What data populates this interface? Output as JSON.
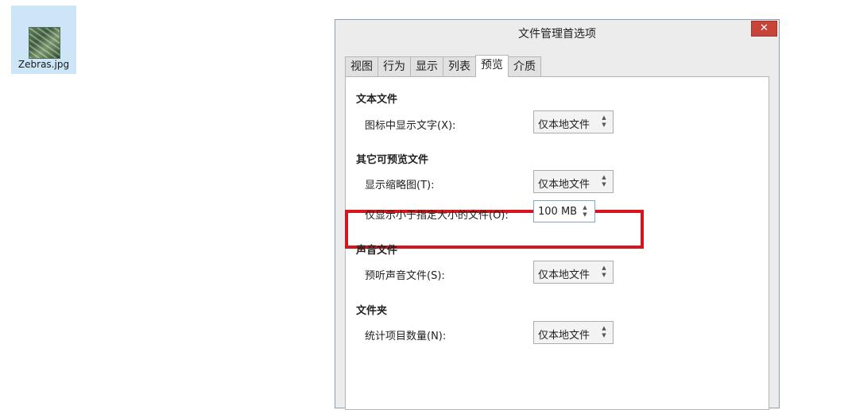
{
  "desktop": {
    "file_name": "Zebras.jpg"
  },
  "dialog": {
    "title": "文件管理首选项",
    "close_glyph": "✕",
    "tabs": [
      "视图",
      "行为",
      "显示",
      "列表",
      "预览",
      "介质"
    ],
    "active_tab": "预览"
  },
  "sections": {
    "text_files": {
      "title": "文本文件",
      "show_text_label": "图标中显示文字(X):",
      "show_text_value": "仅本地文件"
    },
    "other_files": {
      "title": "其它可预览文件",
      "thumbnail_label": "显示缩略图(T):",
      "thumbnail_value": "仅本地文件",
      "size_limit_label": "仅显示小于指定大小的文件(O):",
      "size_limit_value": "100 MB"
    },
    "sound_files": {
      "title": "声音文件",
      "preview_sound_label": "预听声音文件(S):",
      "preview_sound_value": "仅本地文件"
    },
    "folders": {
      "title": "文件夹",
      "count_items_label": "统计项目数量(N):",
      "count_items_value": "仅本地文件"
    }
  },
  "colors": {
    "highlight": "#d7151d",
    "close_button": "#c7443a",
    "selection": "#cde6f7"
  },
  "icons": {
    "spinner_arrows": "▲▼"
  }
}
